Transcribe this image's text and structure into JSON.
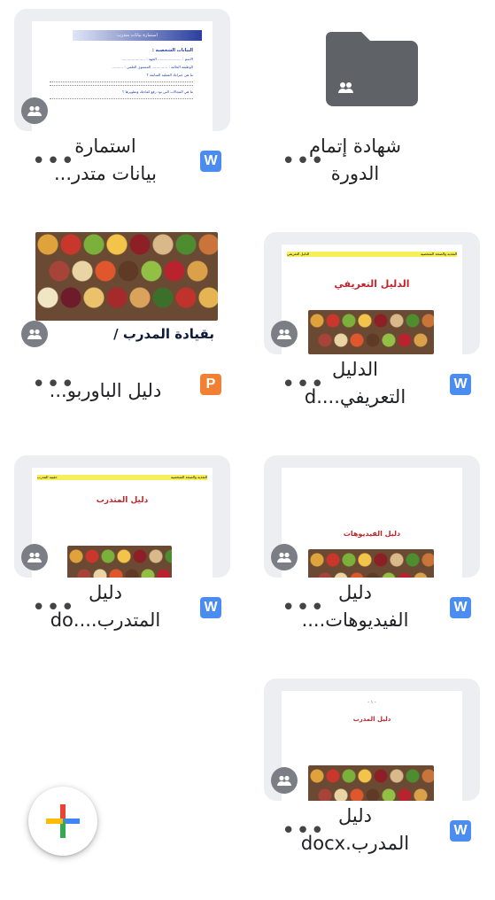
{
  "files": [
    {
      "title": "شهادة إتمام\nالدورة",
      "type_badge": "",
      "kind": "folder",
      "shared": true
    },
    {
      "title": "استمارة\nبيانات متدر...",
      "type_badge": "W",
      "kind": "doc",
      "shared": true,
      "preview": {
        "header": "استمارة بيانات متدرب",
        "section": "البيانات الشخصية :",
        "lines": [
          "الاسم : ..................... الجهة : .....................",
          "الوظيفة الحالية : .............. المستوى العلمي : ..........",
          "ما هي خبراتك العملية السابقة ؟",
          "ما هي المجالات التي تود رفع كفاءتك وتطويرها ؟"
        ]
      }
    },
    {
      "title": "الدليل\nالتعريفي....d",
      "type_badge": "W",
      "kind": "doc",
      "shared": true,
      "preview": {
        "bar_right": "التغذية والصحة الشخصية",
        "bar_left": "الدليل التعريفي",
        "heading": "الدليل التعريفي"
      }
    },
    {
      "title": "دليل الباوربو...",
      "type_badge": "P",
      "kind": "slides",
      "shared": true,
      "preview": {
        "caption": "بقيادة المدرب /"
      }
    },
    {
      "title": "دليل\nالفيديوهات....",
      "type_badge": "W",
      "kind": "doc",
      "shared": true,
      "preview": {
        "heading": "دليل الفيديوهات"
      }
    },
    {
      "title": "دليل\nالمتدرب....do",
      "type_badge": "W",
      "kind": "doc",
      "shared": true,
      "preview": {
        "bar_right": "التغذية والصحة الشخصية",
        "bar_left": "حقيبة المدرب",
        "heading": "دليل المتدرب"
      }
    },
    {
      "title": "دليل\nالمدرب.docx",
      "type_badge": "W",
      "kind": "doc",
      "shared": true,
      "preview": {
        "page_no": "- ١ -",
        "heading": "دليل المدرب"
      }
    }
  ],
  "more_label": "•••",
  "colors": {
    "word": "#4a8cf0",
    "powerpoint": "#f18035",
    "folder": "#5f6368",
    "shared": "#7b7f85"
  },
  "fab": {
    "icon": "plus-icon"
  }
}
